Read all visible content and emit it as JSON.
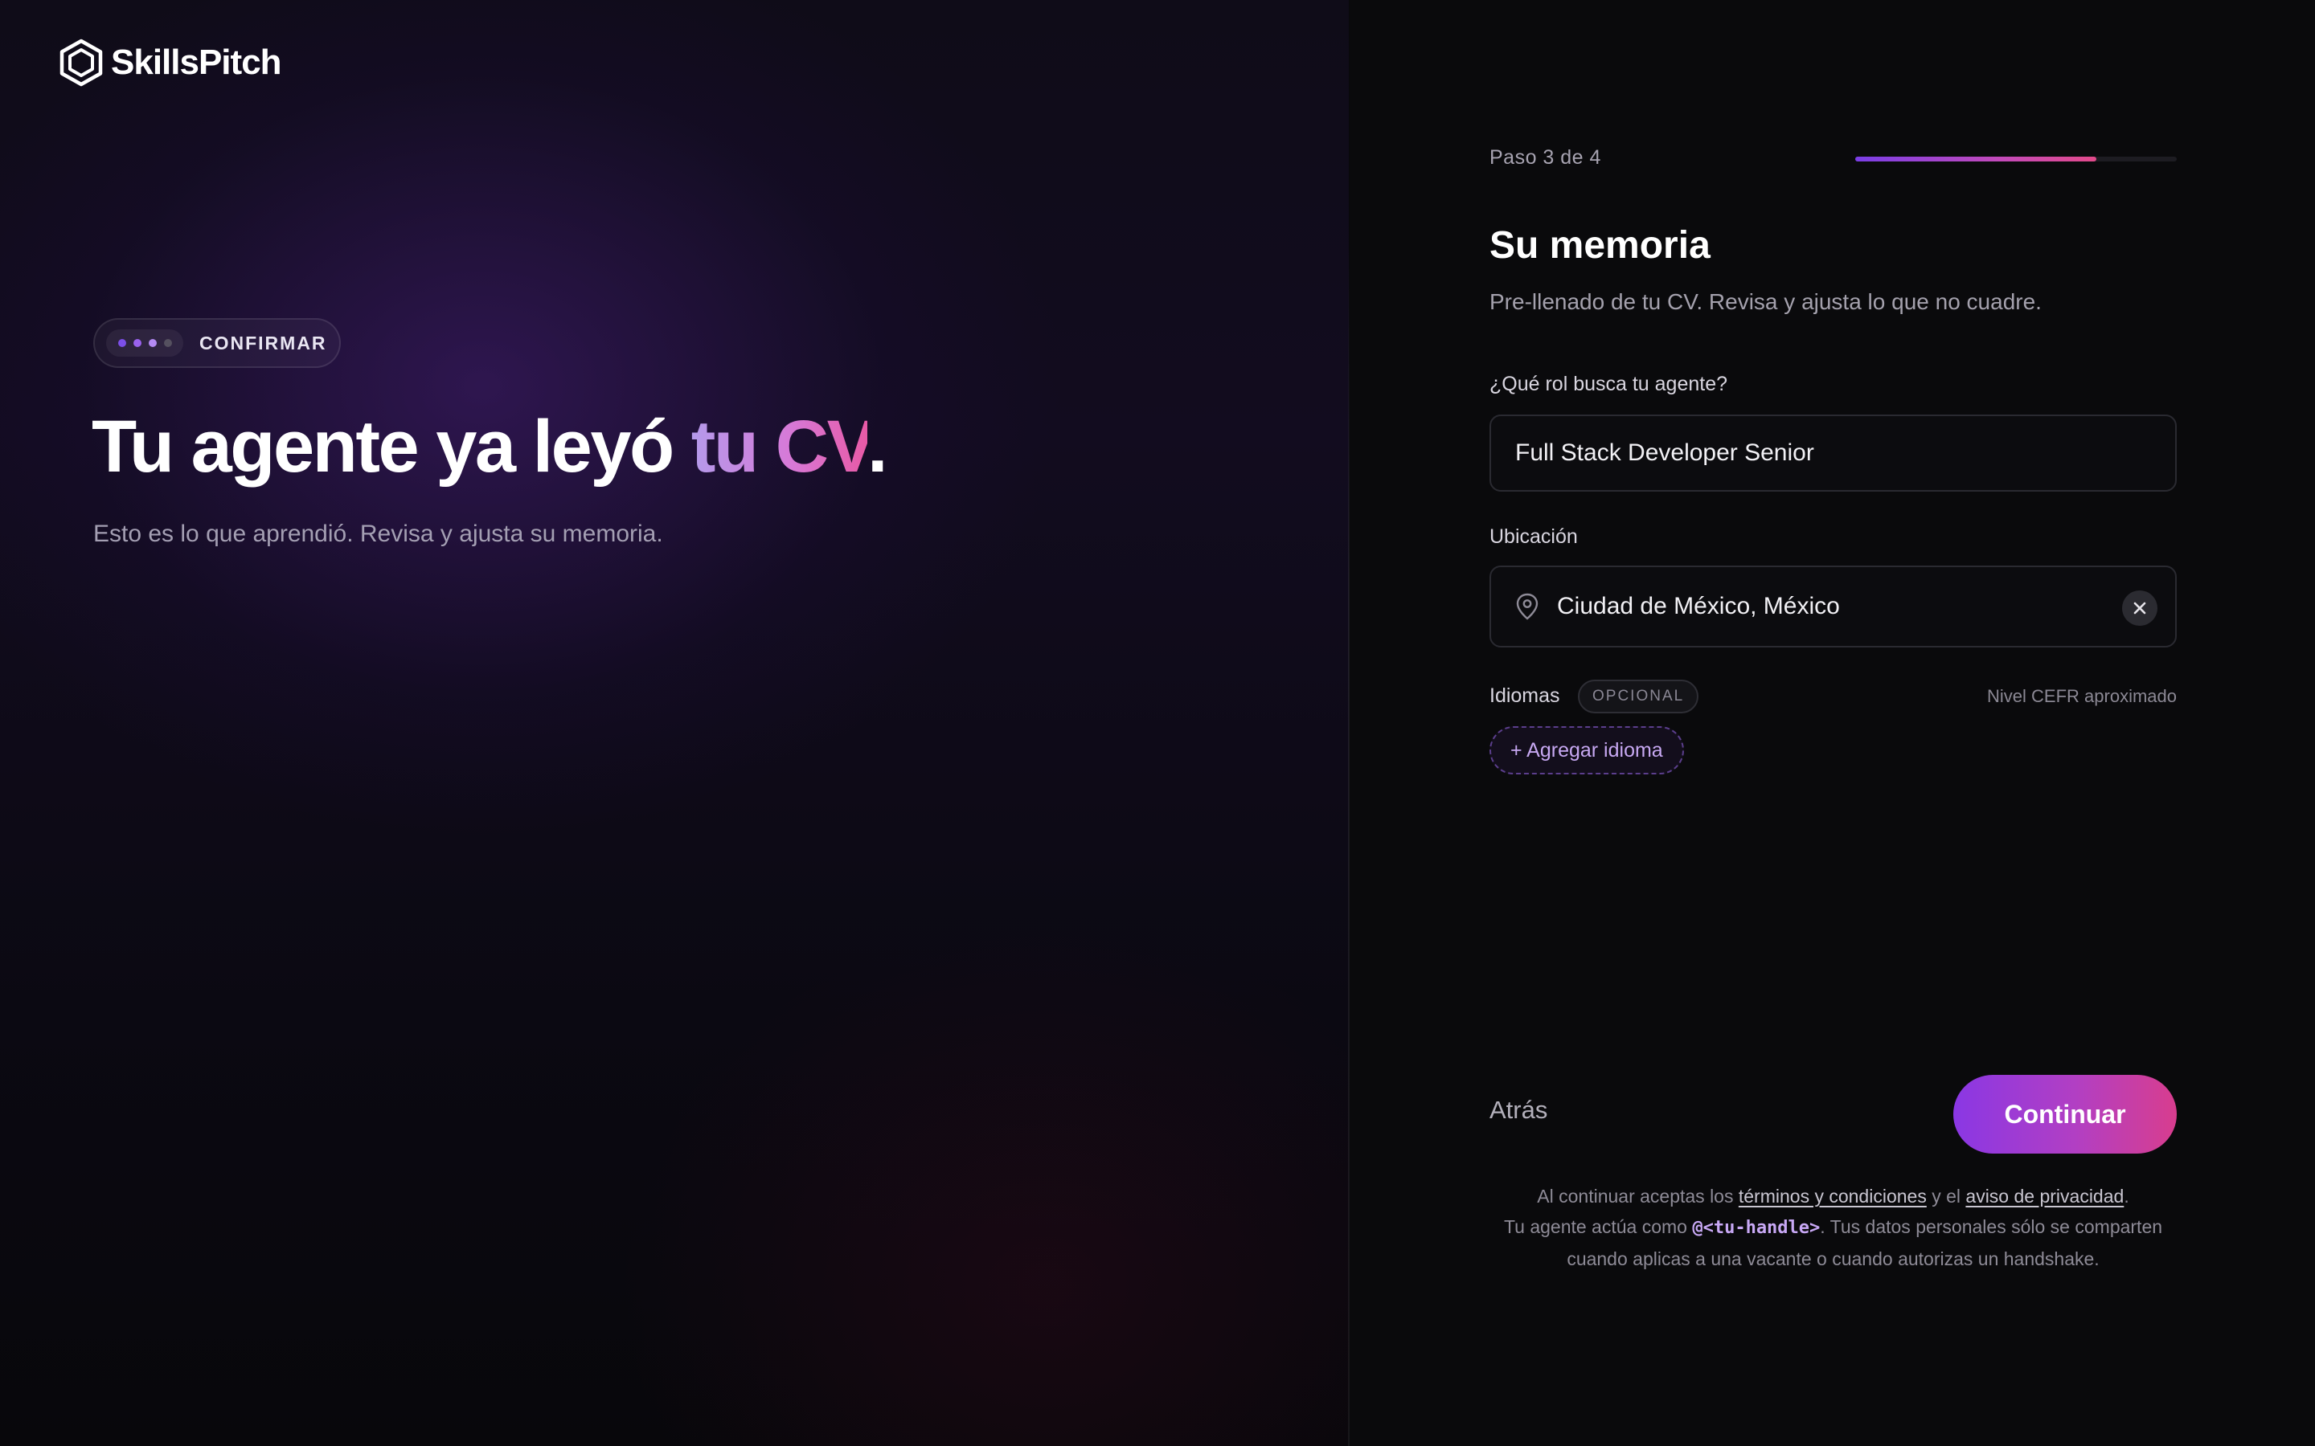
{
  "brand": {
    "name": "SkillsPitch"
  },
  "left": {
    "badge_label": "CONFIRMAR",
    "badge_dot_colors": [
      "#7c4fe8",
      "#9a62ee",
      "#b48af3",
      "#55505f"
    ],
    "title_main": "Tu agente ya leyó ",
    "title_accent": "tu CV",
    "title_end": ".",
    "subtitle": "Esto es lo que aprendió. Revisa y ajusta su memoria."
  },
  "progress": {
    "label": "Paso 3 de 4",
    "fraction": 0.75
  },
  "form": {
    "title": "Su memoria",
    "subtitle": "Pre-llenado de tu CV. Revisa y ajusta lo que no cuadre.",
    "role": {
      "label": "¿Qué rol busca tu agente?",
      "value": "Full Stack Developer Senior"
    },
    "location": {
      "label": "Ubicación",
      "value": "Ciudad de México, México",
      "icon": "map-pin-icon",
      "clear_icon": "close-icon"
    },
    "languages": {
      "label": "Idiomas",
      "optional_badge": "OPCIONAL",
      "note": "Nivel CEFR aproximado",
      "add_button": "+ Agregar idioma"
    }
  },
  "actions": {
    "back": "Atrás",
    "continue": "Continuar"
  },
  "legal": {
    "part1": "Al continuar aceptas los ",
    "terms_link": "términos y condiciones",
    "part2": " y el ",
    "privacy_link": "aviso de privacidad",
    "part3": ".",
    "line2_pre": "Tu agente actúa como ",
    "handle": "@<tu-handle>",
    "line2_post": ". Tus datos personales sólo se comparten cuando aplicas a una vacante o cuando autorizas un handshake."
  },
  "colors": {
    "accent_purple": "#8a37e4",
    "accent_pink": "#d83d8e",
    "background": "#0a0a0c"
  }
}
